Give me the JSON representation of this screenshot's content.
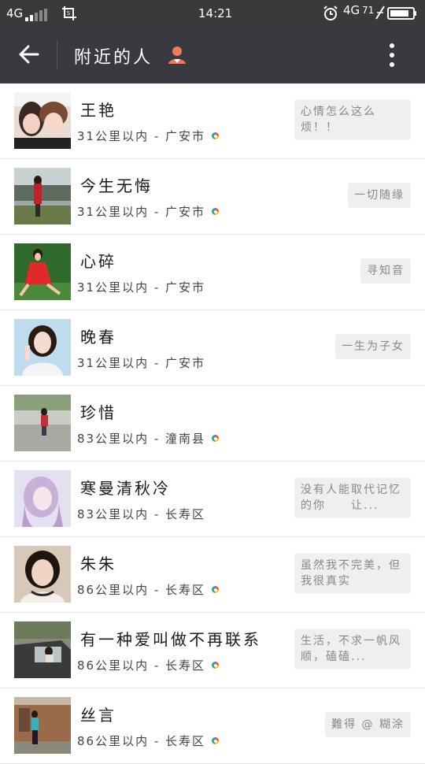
{
  "status": {
    "network_left": "4G",
    "time": "14:21",
    "network_right": "4G",
    "battery": "71"
  },
  "appbar": {
    "title": "附近的人"
  },
  "people": [
    {
      "name": "王艳",
      "distance": "31公里以内 - 广安市",
      "signature": "心情怎么这么烦！！",
      "sig_lines": 2
    },
    {
      "name": "今生无悔",
      "distance": "31公里以内 - 广安市",
      "signature": "一切随缘",
      "sig_lines": 1
    },
    {
      "name": "心碎",
      "distance": "31公里以内 - 广安市",
      "signature": "寻知音",
      "sig_lines": 1
    },
    {
      "name": "晚春",
      "distance": "31公里以内 - 广安市",
      "signature": "一生为子女",
      "sig_lines": 1
    },
    {
      "name": "珍惜",
      "distance": "83公里以内 - 潼南县",
      "signature": "",
      "sig_lines": 0
    },
    {
      "name": "寒曼清秋冷",
      "distance": "83公里以内 - 长寿区",
      "signature": "没有人能取代记忆的你　　让...",
      "sig_lines": 2
    },
    {
      "name": "朱朱",
      "distance": "86公里以内 - 长寿区",
      "signature": "虽然我不完美，但我很真实",
      "sig_lines": 2
    },
    {
      "name": "有一种爱叫做不再联系",
      "distance": "86公里以内 - 长寿区",
      "signature": "生活，不求一帆风顺，磕磕...",
      "sig_lines": 2
    },
    {
      "name": "丝言",
      "distance": "86公里以内 - 长寿区",
      "signature": "難得 @ 糊涂",
      "sig_lines": 1
    }
  ],
  "colors": {
    "appbar": "#393a3f",
    "statusbar": "#3a3a3a",
    "person_icon": "#f07a5a",
    "bubble": "#efefef"
  }
}
